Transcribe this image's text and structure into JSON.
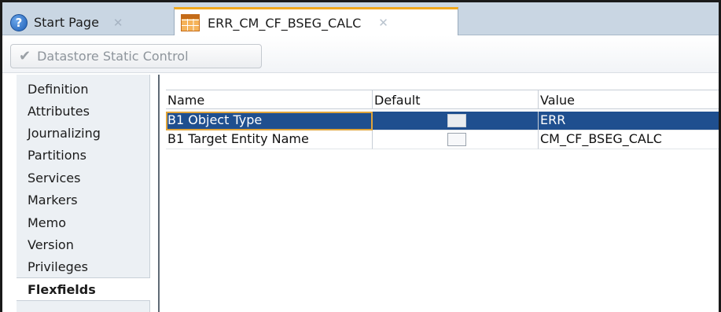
{
  "tabs": [
    {
      "label": "Start Page",
      "icon": "help-icon",
      "active": false
    },
    {
      "label": "ERR_CM_CF_BSEG_CALC",
      "icon": "table-icon",
      "active": true
    }
  ],
  "toolbar": {
    "datastore_button_label": "Datastore Static Control"
  },
  "nav": {
    "items": [
      "Definition",
      "Attributes",
      "Journalizing",
      "Partitions",
      "Services",
      "Markers",
      "Memo",
      "Version",
      "Privileges",
      "Flexfields"
    ],
    "selected": "Flexfields"
  },
  "grid": {
    "columns": [
      "Name",
      "Default",
      "Value"
    ],
    "rows": [
      {
        "name": "B1 Object Type",
        "default_checked": false,
        "value": "ERR",
        "selected": true
      },
      {
        "name": "B1 Target Entity Name",
        "default_checked": false,
        "value": "CM_CF_BSEG_CALC",
        "selected": false
      }
    ]
  },
  "colors": {
    "selection": "#1f4f8f",
    "active_tab_accent": "#f0a81e",
    "tab_bar": "#c9d6e3"
  }
}
